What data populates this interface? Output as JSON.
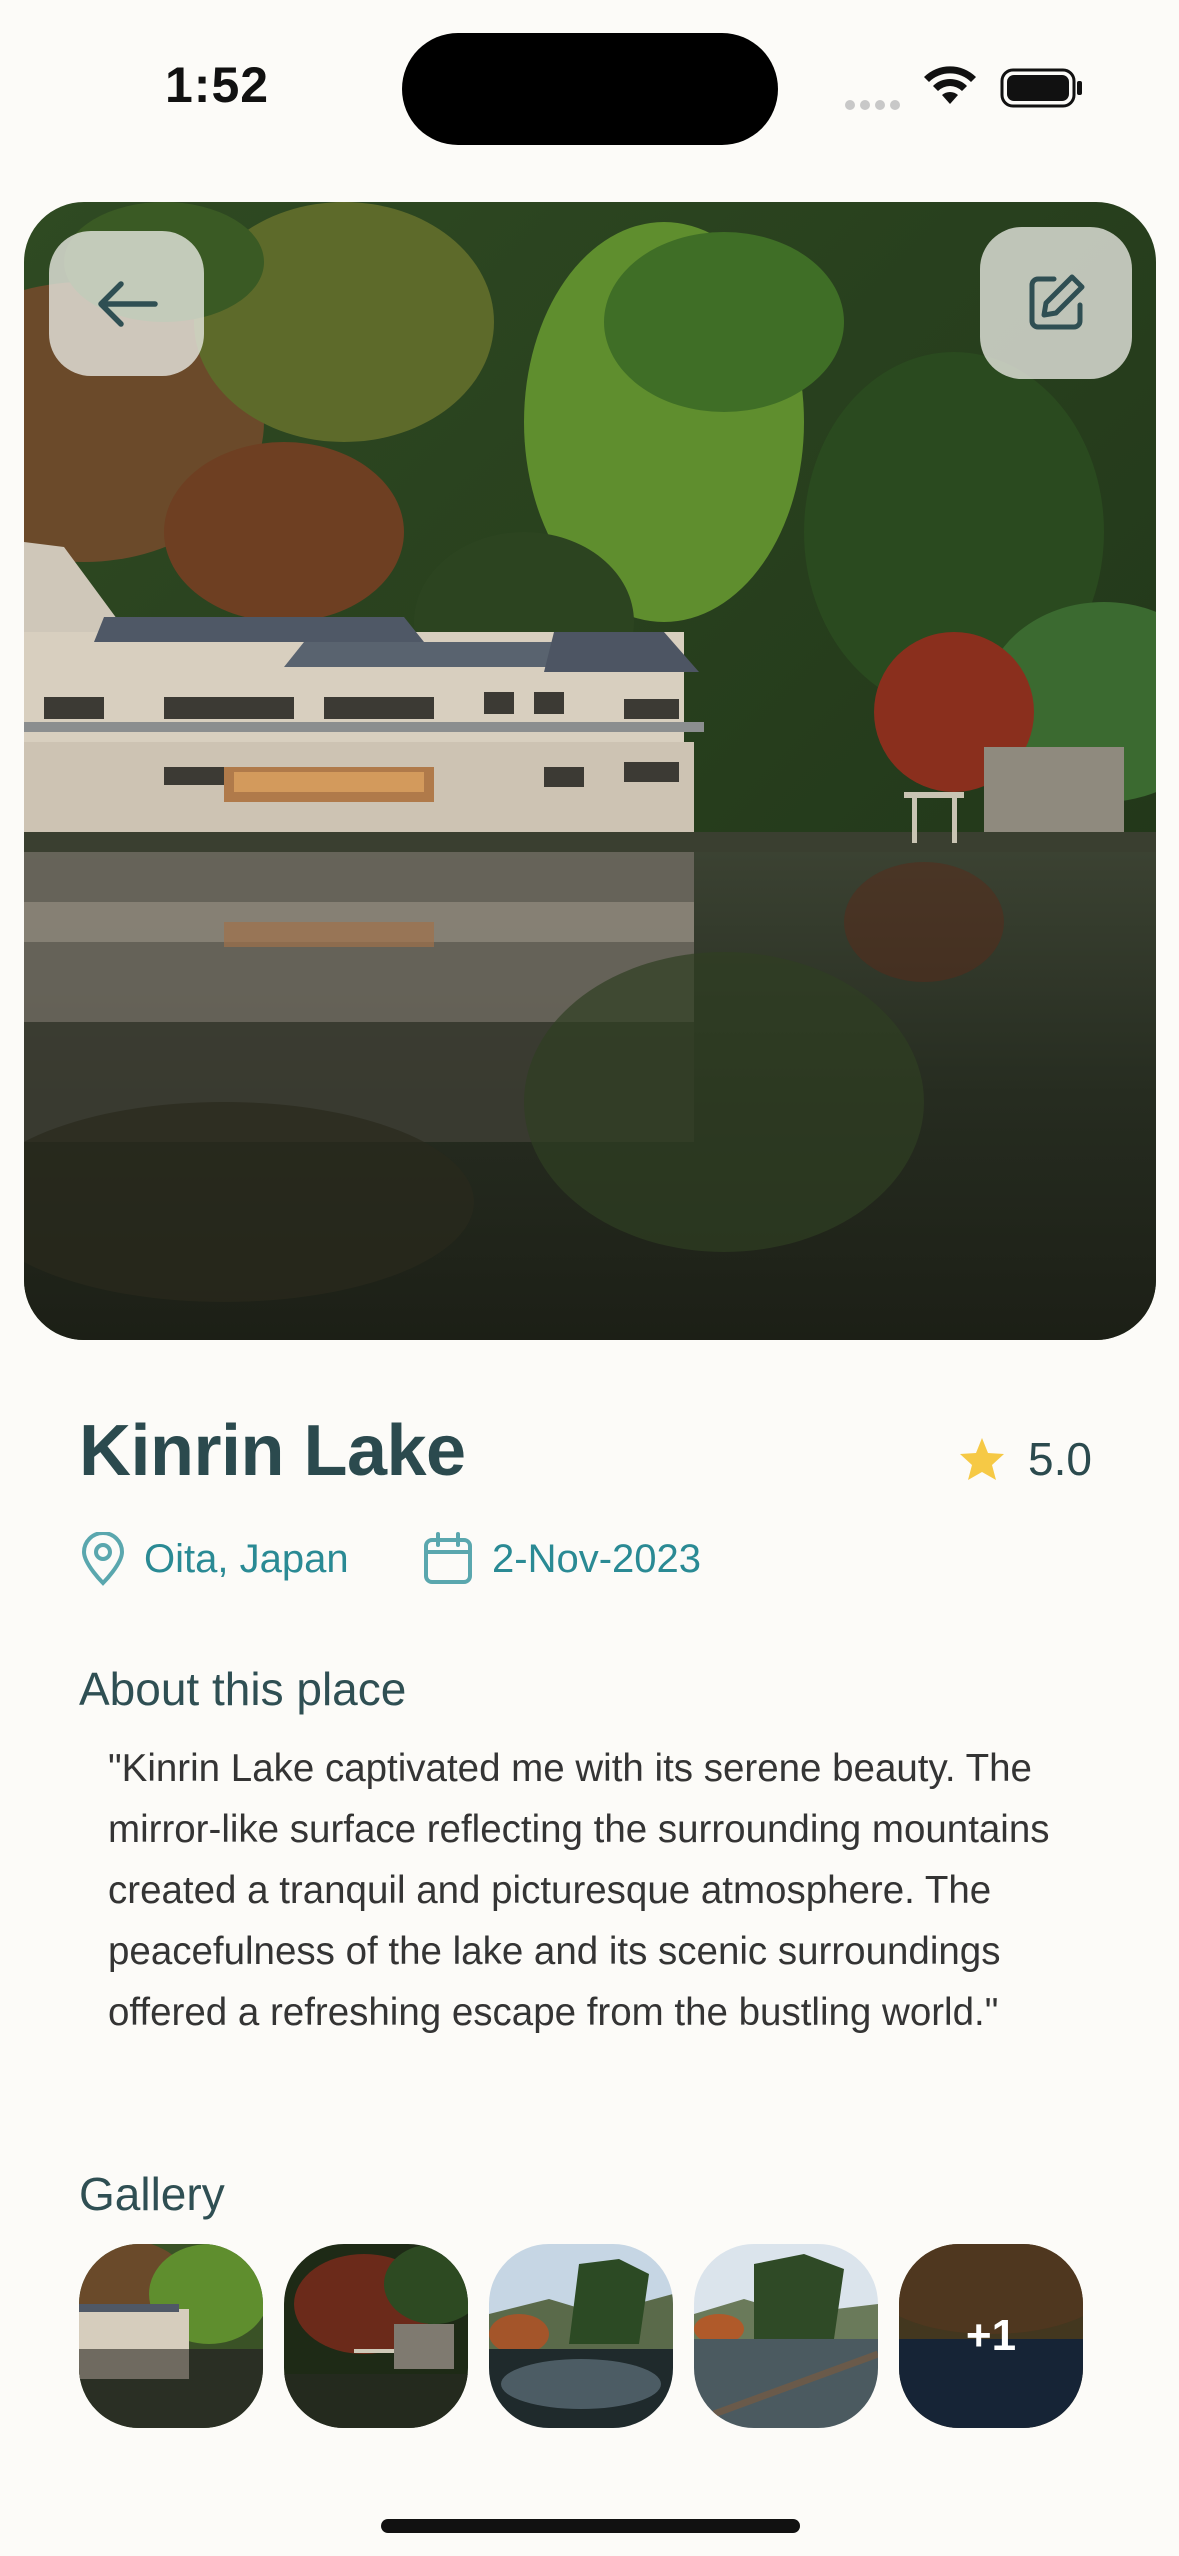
{
  "status_bar": {
    "time": "1:52"
  },
  "place": {
    "title": "Kinrin Lake",
    "rating": "5.0",
    "location": "Oita, Japan",
    "date": "2-Nov-2023"
  },
  "about": {
    "heading": "About this place",
    "text": "\"Kinrin Lake captivated me with its serene beauty. The mirror-like surface reflecting the surrounding mountains created a tranquil and picturesque atmosphere. The peacefulness of the lake and its scenic surroundings offered a refreshing escape from the bustling world.\""
  },
  "gallery": {
    "heading": "Gallery",
    "more_label": "+1"
  },
  "colors": {
    "accent": "#2a8a94",
    "title": "#2b4a4e",
    "star": "#f6c945",
    "background": "#fcfbf8"
  },
  "icons": [
    "back-arrow-icon",
    "edit-icon",
    "star-icon",
    "location-pin-icon",
    "calendar-icon",
    "wifi-icon",
    "battery-icon"
  ]
}
